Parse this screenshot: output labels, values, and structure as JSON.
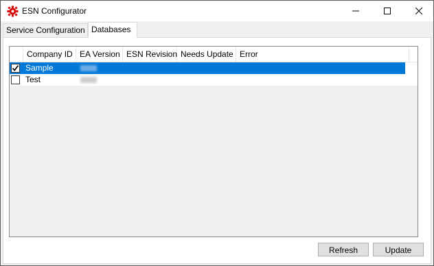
{
  "window": {
    "title": "ESN Configurator",
    "accent": "#d40000"
  },
  "tabs": [
    {
      "label": "Service Configuration",
      "selected": false
    },
    {
      "label": "Databases",
      "selected": true
    }
  ],
  "grid": {
    "columns": [
      "Company ID",
      "EA Version",
      "ESN Revision",
      "Needs Update",
      "Error"
    ],
    "rows": [
      {
        "checked": true,
        "selected": true,
        "company_id": "Sample",
        "ea_version": "",
        "esn_revision": "",
        "needs_update": "",
        "error": ""
      },
      {
        "checked": false,
        "selected": false,
        "company_id": "Test",
        "ea_version": "",
        "esn_revision": "",
        "needs_update": "",
        "error": ""
      }
    ],
    "selection_color": "#0078d7"
  },
  "buttons": {
    "refresh": "Refresh",
    "update": "Update"
  }
}
